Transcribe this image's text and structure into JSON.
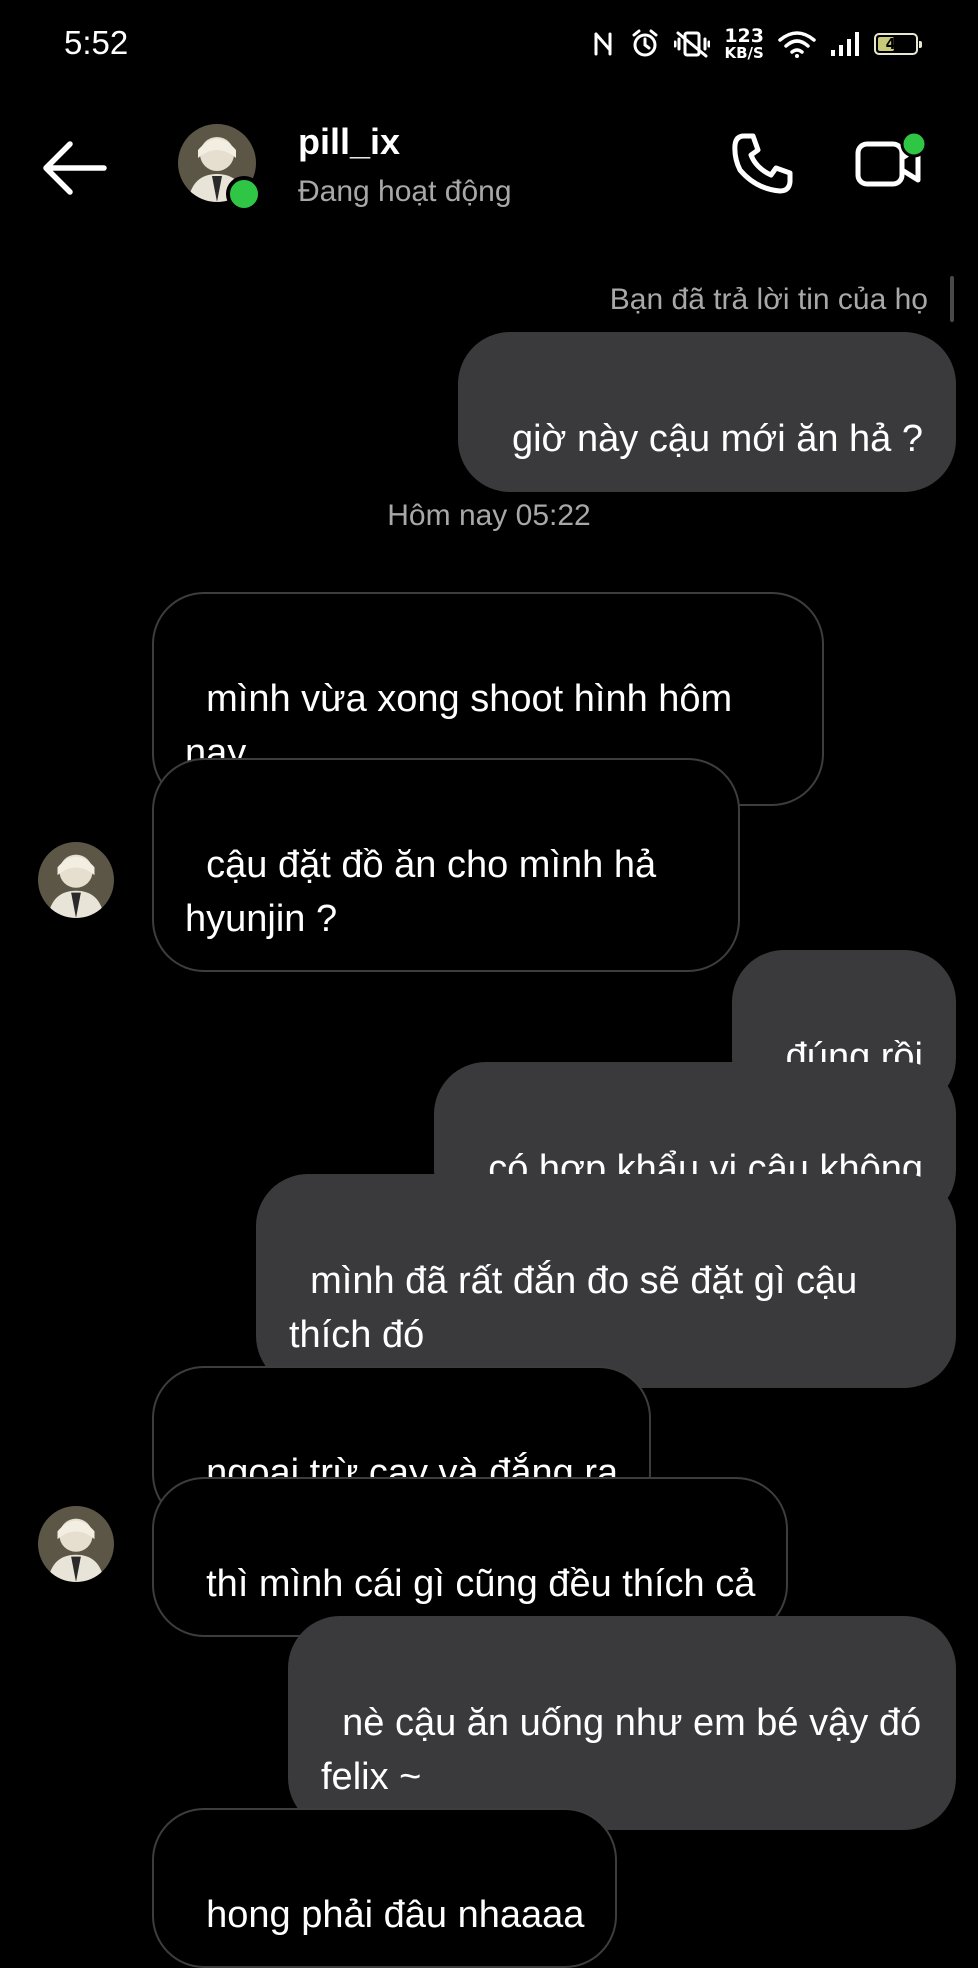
{
  "status_bar": {
    "time": "5:52",
    "net_speed_value": "123",
    "net_speed_unit": "KB/S",
    "battery": "42"
  },
  "header": {
    "username": "pill_ix",
    "status": "Đang hoạt động"
  },
  "reply_note": "Bạn đã trả lời tin của họ",
  "messages_before": [
    {
      "text": "giờ này cậu mới ăn hả ?",
      "direction": "out"
    }
  ],
  "date_separator": "Hôm nay 05:22",
  "messages": [
    {
      "text": "mình vừa xong shoot hình hôm nay",
      "direction": "in"
    },
    {
      "text": "cậu đặt đồ ăn cho mình hả hyunjin ?",
      "direction": "in"
    },
    {
      "text": "đúng rồi",
      "direction": "out"
    },
    {
      "text": "có hợp khẩu vị cậu không",
      "direction": "out"
    },
    {
      "text": "mình đã rất đắn đo sẽ đặt gì cậu thích đó",
      "direction": "out"
    },
    {
      "text": "ngoại trừ cay và đắng ra",
      "direction": "in"
    },
    {
      "text": "thì mình cái gì cũng đều thích cả",
      "direction": "in"
    },
    {
      "text": "nè cậu ăn uống như em bé vậy đó felix ~",
      "direction": "out"
    },
    {
      "text": "hong phải đâu nhaaaa",
      "direction": "in"
    }
  ],
  "colors": {
    "background": "#000000",
    "outgoing_bubble": "#3a3a3c",
    "incoming_border": "#3d3d3d",
    "online": "#30c645",
    "muted_text": "#a8a8a8"
  },
  "icons": [
    "back-arrow-icon",
    "phone-icon",
    "video-call-icon",
    "nfc-icon",
    "alarm-icon",
    "vibrate-icon",
    "wifi-icon",
    "signal-icon",
    "battery-icon"
  ]
}
